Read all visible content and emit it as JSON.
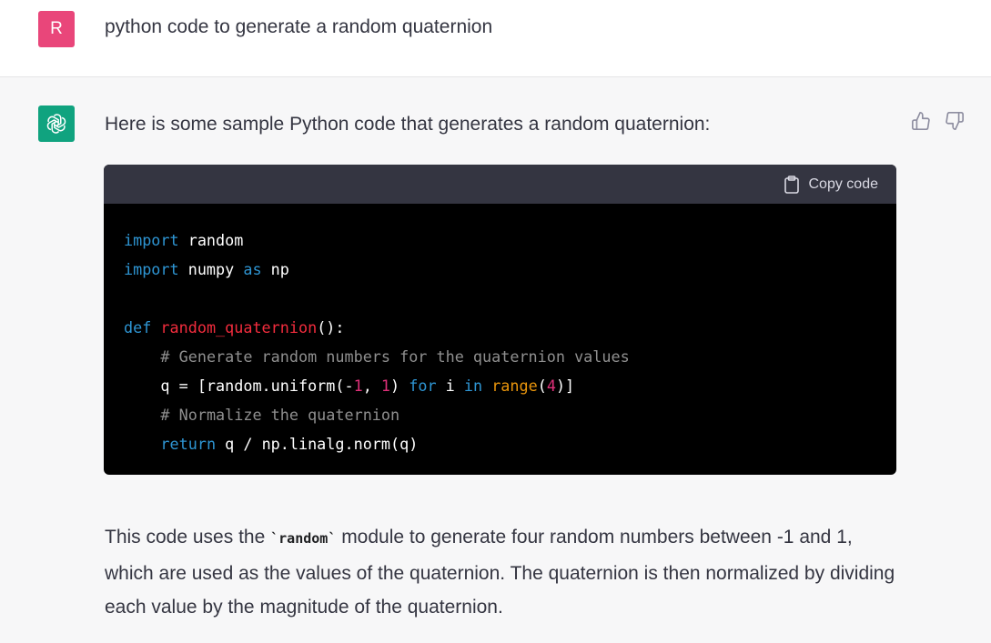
{
  "user": {
    "avatar_letter": "R",
    "message": "python code to generate a random quaternion"
  },
  "assistant": {
    "intro": "Here is some sample Python code that generates a random quaternion:",
    "copy_label": "Copy code",
    "code_lines": [
      "import random",
      "import numpy as np",
      "",
      "def random_quaternion():",
      "    # Generate random numbers for the quaternion values",
      "    q = [random.uniform(-1, 1) for i in range(4)]",
      "    # Normalize the quaternion",
      "    return q / np.linalg.norm(q)"
    ],
    "para_before": "This code uses the ",
    "inline_code": "`random`",
    "para_after": " module to generate four random numbers between -1 and 1, which are used as the values of the quaternion. The quaternion is then normalized by dividing each value by the magnitude of the quaternion."
  },
  "colors": {
    "user_avatar": "#e9467a",
    "assistant_avatar": "#10a37f",
    "code_bg": "#000000",
    "code_header_bg": "#343541",
    "keyword": "#2e95d3",
    "function_name": "#f22c3d",
    "comment": "#8f8f8f",
    "number": "#df3079",
    "builtin": "#e9950c"
  },
  "icons": [
    "openai-logo-icon",
    "thumbs-up-icon",
    "thumbs-down-icon",
    "clipboard-icon"
  ]
}
